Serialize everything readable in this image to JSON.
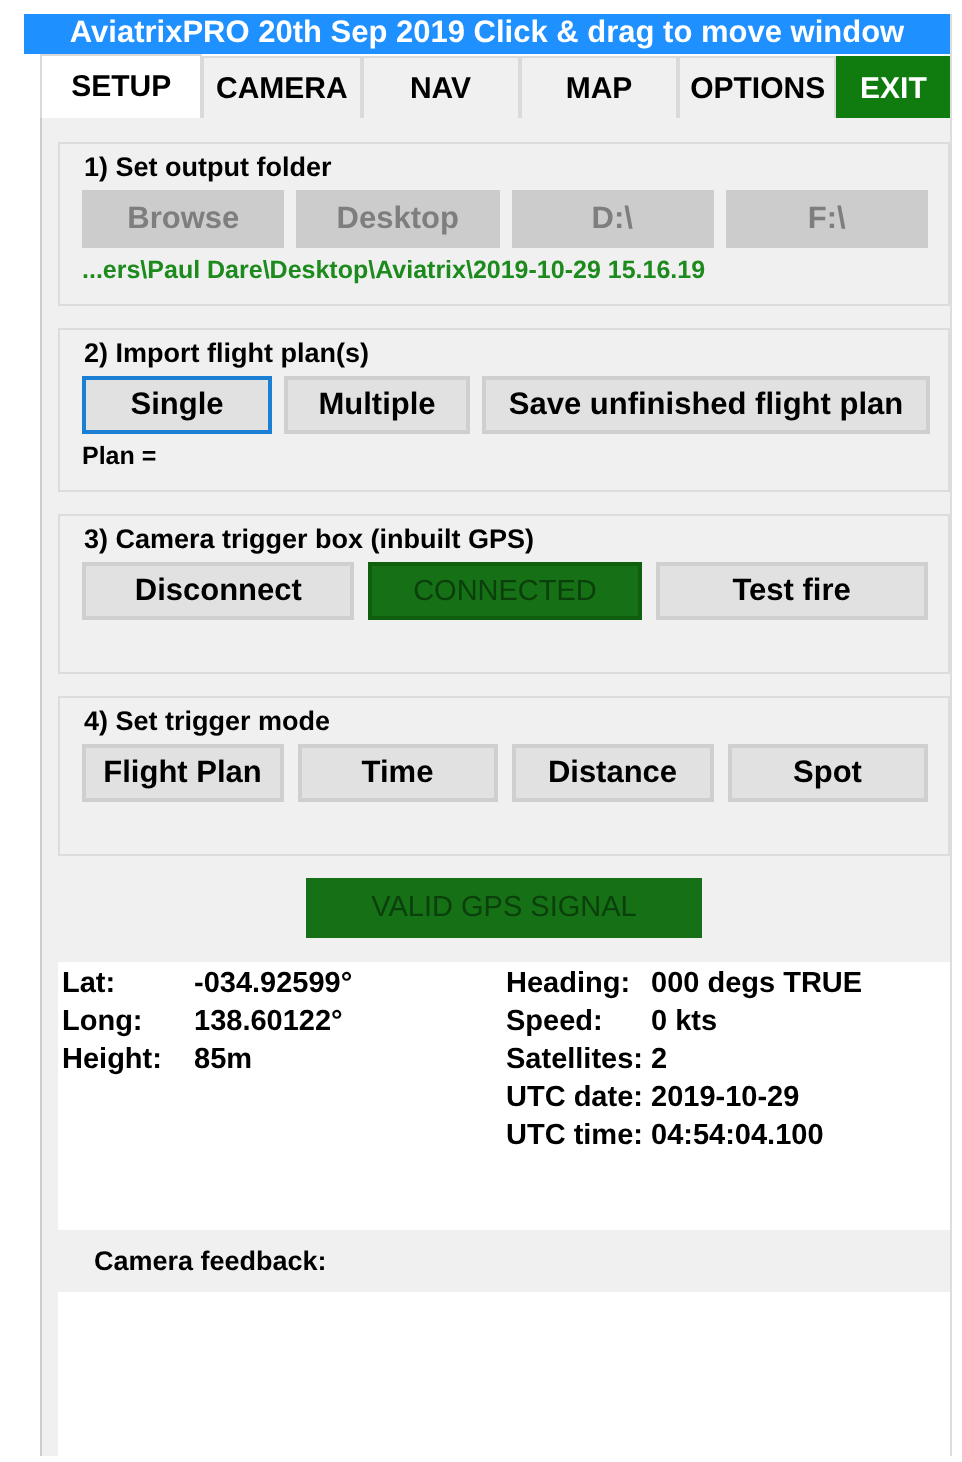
{
  "window": {
    "title": "AviatrixPRO 20th Sep 2019 Click & drag to move window"
  },
  "tabs": [
    {
      "label": "SETUP",
      "selected": true,
      "kind": "tab"
    },
    {
      "label": "CAMERA",
      "selected": false,
      "kind": "tab"
    },
    {
      "label": "NAV",
      "selected": false,
      "kind": "tab"
    },
    {
      "label": "MAP",
      "selected": false,
      "kind": "tab"
    },
    {
      "label": "OPTIONS",
      "selected": false,
      "kind": "tab"
    },
    {
      "label": "EXIT",
      "selected": false,
      "kind": "exit"
    }
  ],
  "sections": [
    {
      "kind": "folder",
      "heading": "1) Set output folder",
      "buttons": [
        {
          "label": "Browse",
          "kind": "button",
          "disabled": true,
          "focused": false
        },
        {
          "label": "Desktop",
          "kind": "button",
          "disabled": true,
          "focused": false
        },
        {
          "label": "D:\\",
          "kind": "button",
          "disabled": true,
          "focused": false
        },
        {
          "label": "F:\\",
          "kind": "button",
          "disabled": true,
          "focused": false
        }
      ],
      "note": {
        "text": "...ers\\Paul Dare\\Desktop\\Aviatrix\\2019-10-29 15.16.19",
        "kind": "path"
      }
    },
    {
      "kind": "import",
      "heading": "2) Import flight plan(s)",
      "buttons": [
        {
          "label": "Single",
          "kind": "button",
          "disabled": false,
          "focused": true
        },
        {
          "label": "Multiple",
          "kind": "button",
          "disabled": false,
          "focused": false
        },
        {
          "label": "Save unfinished flight plan",
          "kind": "button",
          "disabled": false,
          "focused": false
        }
      ],
      "note": {
        "text": "Plan =",
        "kind": "plain"
      }
    },
    {
      "kind": "trigger_box",
      "heading": "3) Camera trigger box (inbuilt GPS)",
      "buttons": [
        {
          "label": "Disconnect",
          "kind": "button",
          "disabled": false,
          "focused": false
        },
        {
          "label": "CONNECTED",
          "kind": "indicator",
          "disabled": false,
          "focused": false
        },
        {
          "label": "Test fire",
          "kind": "button",
          "disabled": false,
          "focused": false
        }
      ]
    },
    {
      "kind": "trigger_mode",
      "heading": "4) Set trigger mode",
      "buttons": [
        {
          "label": "Flight Plan",
          "kind": "button",
          "disabled": false,
          "focused": false
        },
        {
          "label": "Time",
          "kind": "button",
          "disabled": false,
          "focused": false
        },
        {
          "label": "Distance",
          "kind": "button",
          "disabled": false,
          "focused": false
        },
        {
          "label": "Spot",
          "kind": "button",
          "disabled": false,
          "focused": false
        }
      ]
    }
  ],
  "gps_status": {
    "label": "VALID GPS SIGNAL"
  },
  "readout": {
    "left": [
      {
        "label": "Lat:",
        "value": "-034.92599°"
      },
      {
        "label": "Long:",
        "value": "138.60122°"
      },
      {
        "label": "Height:",
        "value": "85m"
      }
    ],
    "right": [
      {
        "label": "Heading:",
        "value": "000 degs TRUE"
      },
      {
        "label": "Speed:",
        "value": "0 kts"
      },
      {
        "label": "Satellites:",
        "value": "2"
      },
      {
        "label": "UTC date:",
        "value": "2019-10-29"
      },
      {
        "label": "UTC time:",
        "value": "04:54:04.100"
      }
    ]
  },
  "camera_feedback": {
    "label": "Camera feedback:"
  }
}
